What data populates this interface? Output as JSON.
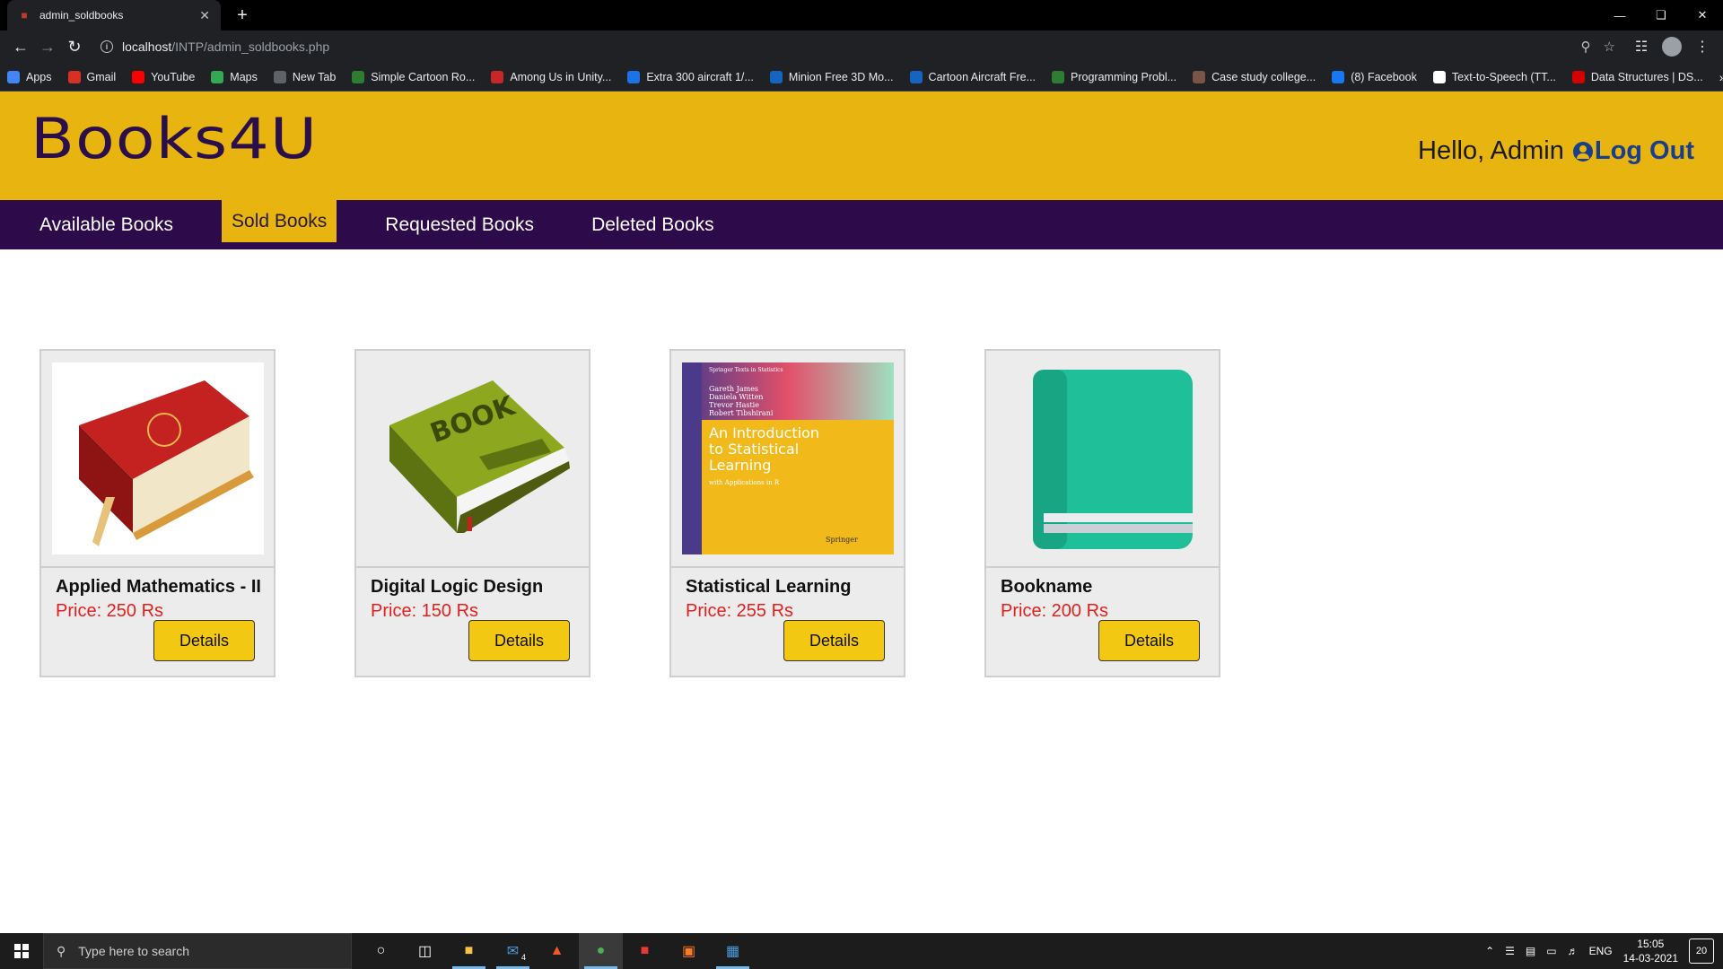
{
  "browser": {
    "tab_title": "admin_soldbooks",
    "url_host": "localhost",
    "url_path": "/INTP/admin_soldbooks.php",
    "bookmarks": [
      {
        "label": "Apps",
        "color": "#4285f4"
      },
      {
        "label": "Gmail",
        "color": "#d93025"
      },
      {
        "label": "YouTube",
        "color": "#ff0000"
      },
      {
        "label": "Maps",
        "color": "#34a853"
      },
      {
        "label": "New Tab",
        "color": "#5f6368"
      },
      {
        "label": "Simple Cartoon Ro...",
        "color": "#2e7d32"
      },
      {
        "label": "Among Us in Unity...",
        "color": "#c62828"
      },
      {
        "label": "Extra 300 aircraft 1/...",
        "color": "#1a73e8"
      },
      {
        "label": "Minion Free 3D Mo...",
        "color": "#1565c0"
      },
      {
        "label": "Cartoon Aircraft Fre...",
        "color": "#1565c0"
      },
      {
        "label": "Programming Probl...",
        "color": "#2e7d32"
      },
      {
        "label": "Case study college...",
        "color": "#795548"
      },
      {
        "label": "(8) Facebook",
        "color": "#1877f2"
      },
      {
        "label": "Text-to-Speech (TT...",
        "color": "#ffffff"
      },
      {
        "label": "Data Structures | DS...",
        "color": "#d50000"
      }
    ]
  },
  "site": {
    "logo": "Books4U",
    "greeting": "Hello, Admin",
    "logout": "Log Out",
    "nav": [
      {
        "label": "Available Books",
        "active": false
      },
      {
        "label": "Sold Books",
        "active": true
      },
      {
        "label": "Requested Books",
        "active": false
      },
      {
        "label": "Deleted Books",
        "active": false
      }
    ],
    "books": [
      {
        "name": "Applied Mathematics - II",
        "price": "Price: 250 Rs",
        "button": "Details"
      },
      {
        "name": "Digital Logic Design",
        "price": "Price: 150 Rs",
        "button": "Details"
      },
      {
        "name": "Statistical Learning",
        "price": "Price: 255 Rs",
        "button": "Details"
      },
      {
        "name": "Bookname",
        "price": "Price: 200 Rs",
        "button": "Details"
      }
    ],
    "cover_texts": {
      "green_book": "BOOK",
      "stats_series": "Springer Texts in Statistics",
      "stats_authors": [
        "Gareth James",
        "Daniela Witten",
        "Trevor Hastie",
        "Robert Tibshirani"
      ],
      "stats_title": [
        "An Introduction",
        "to Statistical",
        "Learning"
      ],
      "stats_subtitle": "with Applications in R",
      "stats_publisher": "Springer"
    },
    "colors": {
      "header": "#e8b40f",
      "nav": "#2d0a4a",
      "price": "#e3201e",
      "button": "#f2c813"
    }
  },
  "taskbar": {
    "search_placeholder": "Type here to search",
    "mail_badge": "4",
    "lang": "ENG",
    "time": "15:05",
    "date": "14-03-2021",
    "notifications": "20"
  }
}
